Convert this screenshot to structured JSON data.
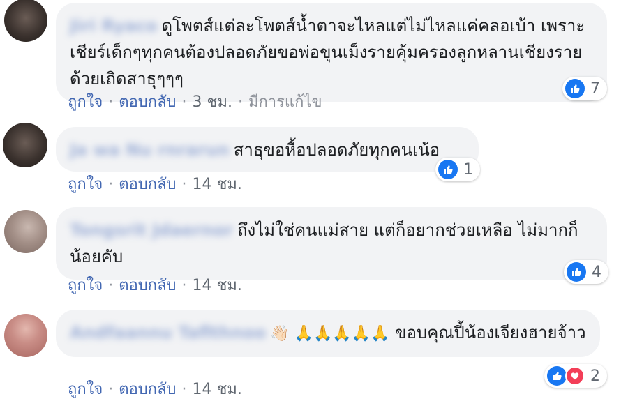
{
  "comments": [
    {
      "author": "Jiri Ryaco",
      "text": "ดูโพตส์แต่ละโพตส์น้ำตาจะไหลแต่ไม่ไหลแค่คลอเบ้า เพราะเชียร์เด็กๆทุกคนต้องปลอดภัยขอพ่อขุนเม็งรายคุ้มครองลูกหลานเชียงรายด้วยเถิดสาธุๆๆๆ",
      "like_label": "ถูกใจ",
      "reply_label": "ตอบกลับ",
      "time": "3 ชม.",
      "edited": "มีการแก้ไข",
      "reaction_count": "7"
    },
    {
      "author": "Ja wa Nu rnrarun",
      "text": "สาธุขอหื้อปลอดภัยทุกคนเน้อ",
      "like_label": "ถูกใจ",
      "reply_label": "ตอบกลับ",
      "time": "14 ชม.",
      "reaction_count": "1"
    },
    {
      "author": "Tongsrit Jdaernor",
      "text": "ถึงไม่ใช่คนแม่สาย แต่ก็อยากช่วยเหลือ ไม่มากก็น้อยคับ",
      "like_label": "ถูกใจ",
      "reply_label": "ตอบกลับ",
      "time": "14 ชม.",
      "reaction_count": "4"
    },
    {
      "author": "Andfaannu Taflthnoo",
      "text": "ขอบคุณปี้น้องเจียงฮายจ้าว",
      "emojis": "👋🏻 🙏🙏🙏🙏🙏",
      "like_label": "ถูกใจ",
      "reply_label": "ตอบกลับ",
      "time": "14 ชม.",
      "reaction_count": "2"
    }
  ],
  "colors": {
    "bubble": "#f2f3f5",
    "link": "#4267b2",
    "like": "#1877f2",
    "love": "#f33e58"
  }
}
